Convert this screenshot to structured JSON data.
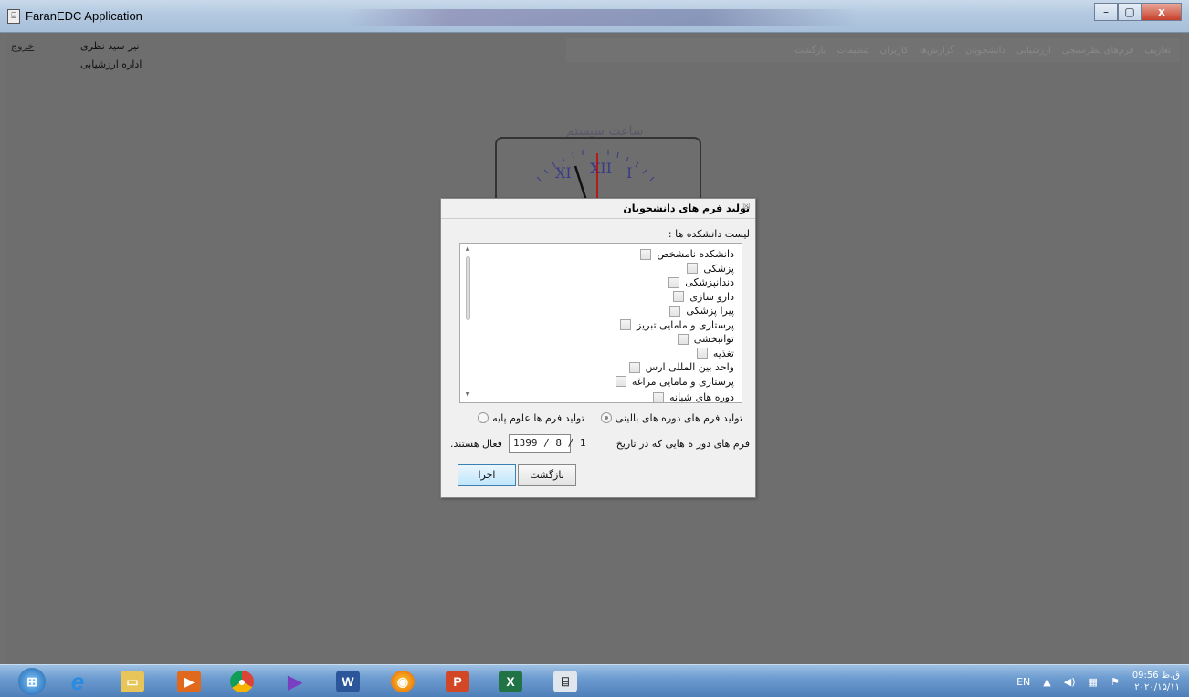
{
  "window": {
    "title": "FaranEDC Application",
    "controls": {
      "minimize": "–",
      "maximize": "▢",
      "close": "x"
    }
  },
  "header": {
    "logout": "خروج",
    "user_name": "نیر سید نظری",
    "user_department": "اداره ارزشیابی"
  },
  "menu": [
    "تعاریف",
    "فرم‌های نظرسنجی",
    "ارزشیابی",
    "دانشجویان",
    "گزارش‌ها",
    "کاربران",
    "تنظیمات",
    "بازگشت"
  ],
  "clock": {
    "title": "ساعت سیستم"
  },
  "dialog": {
    "title": "تولید فرم های دانشجویان",
    "close": "☒",
    "list_label": "لیست دانشکده ها :",
    "faculties": [
      "دانشکده نامشخص",
      "پزشکی",
      "دندانپزشکی",
      "دارو سازی",
      "پیرا پزشکی",
      "پرستاری و مامایی تبریز",
      "توانبخشی",
      "تغذیه",
      "واحد بین المللی ارس",
      "پرستاری و مامایی مراغه",
      "دوره های شبانه"
    ],
    "radio_basic": "تولید فرم ها  علوم پایه",
    "radio_clinical": "تولید فرم های دوره های بالینی",
    "selected_radio": "clinical",
    "date_prefix": "فرم های دور ه هایی که در تاریخ",
    "date_value": "1399 / 8 / 1",
    "date_suffix": "فعال هستند.",
    "back_button": "بازگشت",
    "run_button": "اجرا"
  },
  "taskbar": {
    "apps": [
      "start",
      "internet-explorer",
      "file-explorer",
      "media-player",
      "chrome",
      "visual-studio",
      "word",
      "firefox",
      "powerpoint",
      "excel",
      "faranedc"
    ],
    "language": "EN",
    "time": "09:56 ق.ظ",
    "date": "۲۰۲۰/۱۵/۱۱"
  },
  "colors": {
    "accent": "#3c7fb1",
    "taskbar": "#6d9cd0",
    "background": "#6e6e6e"
  }
}
